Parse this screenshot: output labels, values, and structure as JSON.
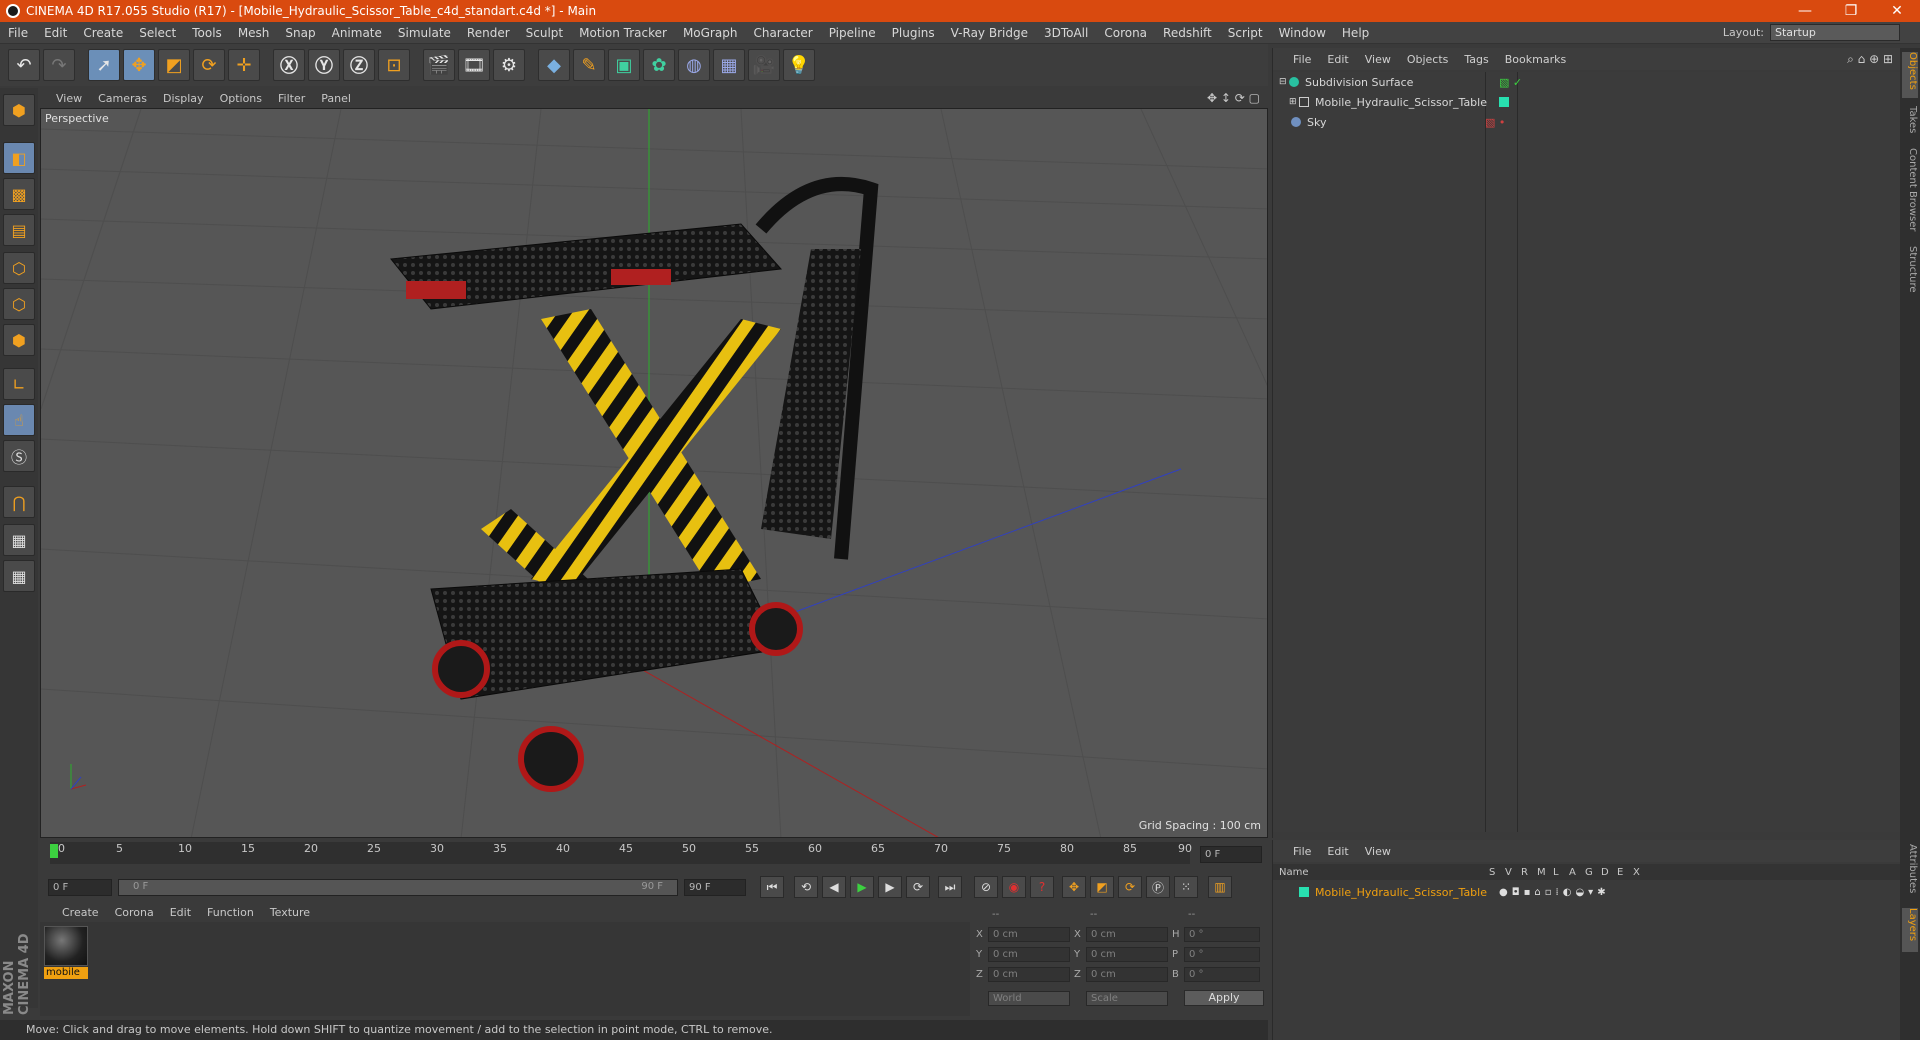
{
  "titlebar": {
    "title": "CINEMA 4D R17.055 Studio (R17) - [Mobile_Hydraulic_Scissor_Table_c4d_standart.c4d *] - Main",
    "min": "—",
    "max": "❐",
    "close": "✕"
  },
  "menubar": {
    "items": [
      "File",
      "Edit",
      "Create",
      "Select",
      "Tools",
      "Mesh",
      "Snap",
      "Animate",
      "Simulate",
      "Render",
      "Sculpt",
      "Motion Tracker",
      "MoGraph",
      "Character",
      "Pipeline",
      "Plugins",
      "V-Ray Bridge",
      "3DToAll",
      "Corona",
      "Redshift",
      "Script",
      "Window",
      "Help"
    ],
    "layout_label": "Layout:",
    "layout_value": "Startup"
  },
  "viewport": {
    "menu": [
      "View",
      "Cameras",
      "Display",
      "Options",
      "Filter",
      "Panel"
    ],
    "label": "Perspective",
    "grid_spacing": "Grid Spacing : 100 cm"
  },
  "timeline": {
    "ticks": [
      "0",
      "5",
      "10",
      "15",
      "20",
      "25",
      "30",
      "35",
      "40",
      "45",
      "50",
      "55",
      "60",
      "65",
      "70",
      "75",
      "80",
      "85",
      "90"
    ],
    "current_frame": "0 F",
    "start_field": "0 F",
    "range_start": "0 F",
    "range_end": "90 F",
    "end_field": "90 F"
  },
  "material_manager": {
    "menu": [
      "Create",
      "Corona",
      "Edit",
      "Function",
      "Texture"
    ],
    "material_name": "mobile"
  },
  "coordinates": {
    "header": [
      "--",
      "--",
      "--"
    ],
    "rows": [
      {
        "a": "X",
        "v1": "0 cm",
        "b": "X",
        "v2": "0 cm",
        "c": "H",
        "v3": "0 °"
      },
      {
        "a": "Y",
        "v1": "0 cm",
        "b": "Y",
        "v2": "0 cm",
        "c": "P",
        "v3": "0 °"
      },
      {
        "a": "Z",
        "v1": "0 cm",
        "b": "Z",
        "v2": "0 cm",
        "c": "B",
        "v3": "0 °"
      }
    ],
    "world": "World",
    "scale": "Scale",
    "apply": "Apply"
  },
  "object_manager": {
    "menu": [
      "File",
      "Edit",
      "View",
      "Objects",
      "Tags",
      "Bookmarks"
    ],
    "objects": [
      {
        "name": "Subdivision Surface",
        "color": "#28c0a0"
      },
      {
        "name": "Mobile_Hydraulic_Scissor_Table",
        "color": "#28c0a0"
      },
      {
        "name": "Sky",
        "color": "#7090c0"
      }
    ]
  },
  "attributes": {
    "menu": [
      "File",
      "Edit",
      "View"
    ],
    "columns": [
      "Name",
      "S",
      "V",
      "R",
      "M",
      "L",
      "A",
      "G",
      "D",
      "E",
      "X"
    ],
    "row_name": "Mobile_Hydraulic_Scissor_Table"
  },
  "side_tabs": [
    "Objects",
    "Takes",
    "Content Browser",
    "Structure",
    "Attributes",
    "Layers"
  ],
  "statusbar": {
    "text": "Move: Click and drag to move elements. Hold down SHIFT to quantize movement / add to the selection in point mode, CTRL to remove."
  },
  "branding": {
    "text": "MAXON CINEMA 4D"
  },
  "colors": {
    "accent": "#d94a0f",
    "highlight": "#f0a010",
    "selected_tool": "#6b8fb8"
  }
}
